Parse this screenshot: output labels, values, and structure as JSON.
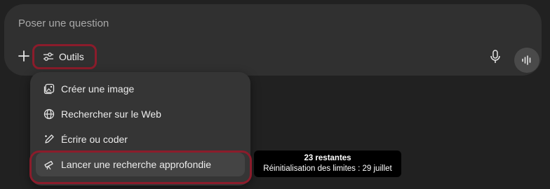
{
  "composer": {
    "placeholder": "Poser une question",
    "tools_label": "Outils"
  },
  "icons": {
    "plus": "plus-icon",
    "tools": "sliders-icon",
    "mic": "microphone-icon",
    "voice": "voice-waveform-icon"
  },
  "menu": {
    "items": [
      {
        "label": "Créer une image",
        "icon": "image-icon"
      },
      {
        "label": "Rechercher sur le Web",
        "icon": "globe-icon"
      },
      {
        "label": "Écrire ou coder",
        "icon": "pen-icon"
      },
      {
        "label": "Lancer une recherche approfondie",
        "icon": "telescope-icon"
      }
    ]
  },
  "tooltip": {
    "remaining": "23 restantes",
    "reset": "Réinitialisation des limites : 29 juillet"
  },
  "colors": {
    "background": "#212121",
    "composer": "#303030",
    "menu": "#353535",
    "highlight": "#8b1c2b",
    "tooltip": "#000000"
  }
}
